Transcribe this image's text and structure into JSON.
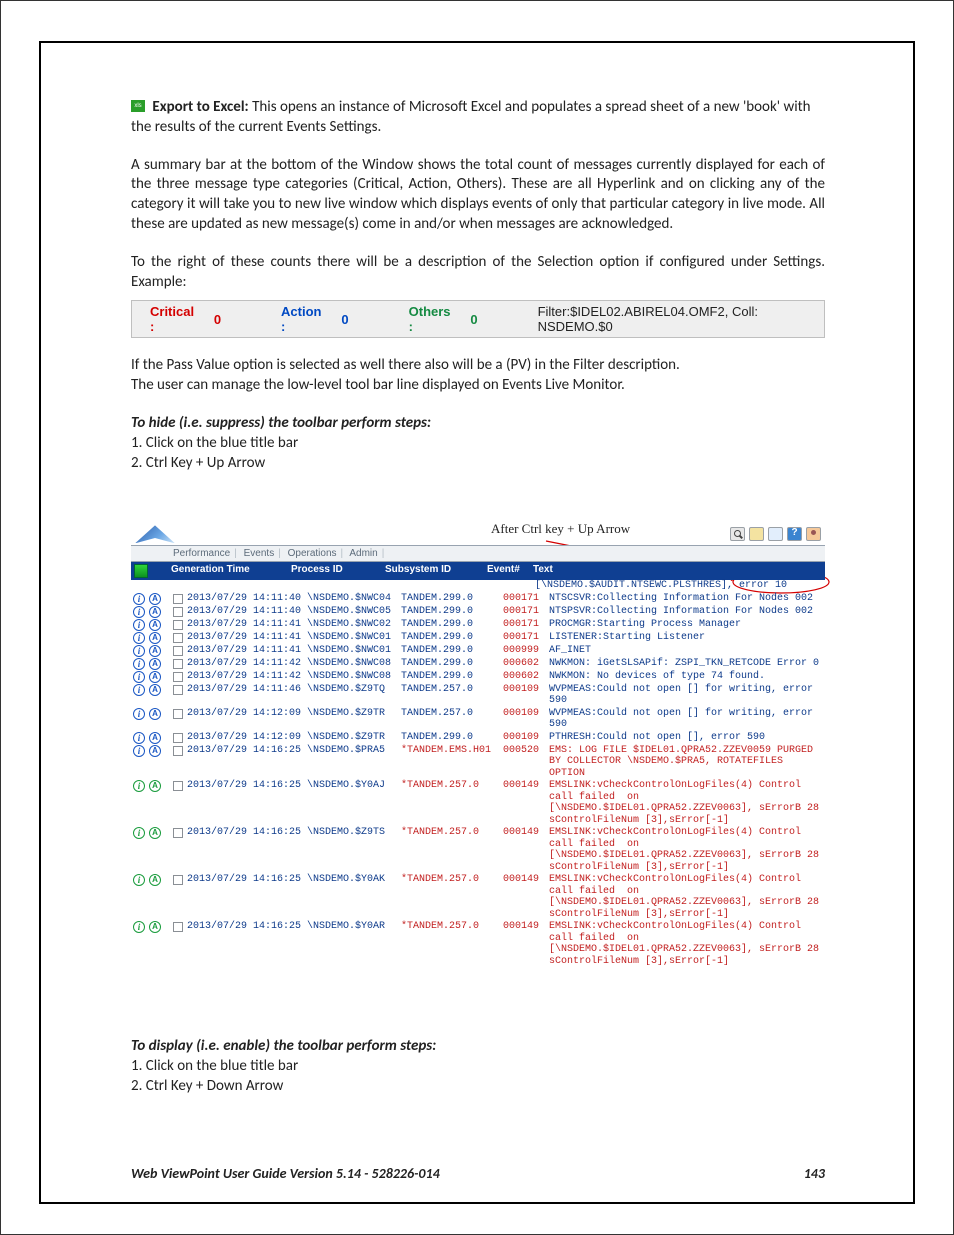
{
  "intro": {
    "export_strong": "Export to Excel:",
    "export_rest": " This opens an instance of Microsoft Excel and populates a spread sheet of a new 'book' with the results of the current Events Settings.",
    "summary_para": "A summary bar at the bottom of the Window shows the total count of messages currently displayed for each of the three message type categories (Critical, Action, Others). These are all Hyperlink and on clicking any of the category it will take you to new live window which displays events of only that particular category in live mode. All these are updated as new message(s) come in and/or when messages are acknowledged.",
    "right_para": "To the right of these counts there will be a description of the Selection option if configured under Settings. Example:"
  },
  "summary_bar": {
    "critical_label": "Critical :",
    "critical_value": "0",
    "action_label": "Action :",
    "action_value": "0",
    "others_label": "Others :",
    "others_value": "0",
    "filter_text": "Filter:$IDEL02.ABIREL04.OMF2, Coll: NSDEMO.$0"
  },
  "mid": {
    "pv_line": "If the Pass Value option is selected as well there also will be a (PV) in the Filter description.",
    "manage_line": "The user can manage the low-level tool bar line displayed on Events Live Monitor.",
    "hide_heading": "To hide (i.e. suppress) the toolbar perform steps:",
    "hide_step1": "1. Click on the blue title bar",
    "hide_step2": "2. Ctrl Key + Up Arrow",
    "callout": "After Ctrl key + Up Arrow"
  },
  "app": {
    "menu": {
      "perf": "Performance",
      "evt": "Events",
      "ops": "Operations",
      "adm": "Admin"
    },
    "head": {
      "gen": "Generation Time",
      "proc": "Process ID",
      "sub": "Subsystem ID",
      "ev": "Event#",
      "txt": "Text"
    },
    "pre_row_text": "[\\NSDEMO.$AUDIT.NTSEWC.PLSTHRES], error 10",
    "rows": [
      {
        "sev": "blue",
        "gt": "2013/07/29 14:11:40",
        "pid": "\\NSDEMO.$NWC04",
        "sub": "TANDEM.299.0",
        "sub_c": "blue",
        "ev": "000171",
        "ev_c": "red",
        "txt": "NTSCSVR:Collecting Information For Nodes 002",
        "txt_c": "blue"
      },
      {
        "sev": "blue",
        "gt": "2013/07/29 14:11:40",
        "pid": "\\NSDEMO.$NWC05",
        "sub": "TANDEM.299.0",
        "sub_c": "blue",
        "ev": "000171",
        "ev_c": "red",
        "txt": "NTSPSVR:Collecting Information For Nodes 002",
        "txt_c": "blue"
      },
      {
        "sev": "blue",
        "gt": "2013/07/29 14:11:41",
        "pid": "\\NSDEMO.$NWC02",
        "sub": "TANDEM.299.0",
        "sub_c": "blue",
        "ev": "000171",
        "ev_c": "red",
        "txt": "PROCMGR:Starting Process Manager",
        "txt_c": "blue"
      },
      {
        "sev": "blue",
        "gt": "2013/07/29 14:11:41",
        "pid": "\\NSDEMO.$NWC01",
        "sub": "TANDEM.299.0",
        "sub_c": "blue",
        "ev": "000171",
        "ev_c": "red",
        "txt": "LISTENER:Starting Listener",
        "txt_c": "blue"
      },
      {
        "sev": "blue",
        "gt": "2013/07/29 14:11:41",
        "pid": "\\NSDEMO.$NWC01",
        "sub": "TANDEM.299.0",
        "sub_c": "blue",
        "ev": "000999",
        "ev_c": "red",
        "txt": "AF_INET",
        "txt_c": "blue"
      },
      {
        "sev": "blue",
        "gt": "2013/07/29 14:11:42",
        "pid": "\\NSDEMO.$NWC08",
        "sub": "TANDEM.299.0",
        "sub_c": "blue",
        "ev": "000602",
        "ev_c": "red",
        "txt": "NWKMON: iGetSLSAPif: ZSPI_TKN_RETCODE Error 0",
        "txt_c": "blue"
      },
      {
        "sev": "blue",
        "gt": "2013/07/29 14:11:42",
        "pid": "\\NSDEMO.$NWC08",
        "sub": "TANDEM.299.0",
        "sub_c": "blue",
        "ev": "000602",
        "ev_c": "red",
        "txt": "NWKMON: No devices of type 74 found.",
        "txt_c": "blue"
      },
      {
        "sev": "blue",
        "gt": "2013/07/29 14:11:46",
        "pid": "\\NSDEMO.$Z9TQ",
        "sub": "TANDEM.257.0",
        "sub_c": "blue",
        "ev": "000109",
        "ev_c": "red",
        "txt": "WVPMEAS:Could not open [] for writing, error 590",
        "txt_c": "blue"
      },
      {
        "sev": "blue",
        "gt": "2013/07/29 14:12:09",
        "pid": "\\NSDEMO.$Z9TR",
        "sub": "TANDEM.257.0",
        "sub_c": "blue",
        "ev": "000109",
        "ev_c": "red",
        "txt": "WVPMEAS:Could not open [] for writing, error 590",
        "txt_c": "blue"
      },
      {
        "sev": "blue",
        "gt": "2013/07/29 14:12:09",
        "pid": "\\NSDEMO.$Z9TR",
        "sub": "TANDEM.299.0",
        "sub_c": "blue",
        "ev": "000109",
        "ev_c": "red",
        "txt": "PTHRESH:Could not open [], error 590",
        "txt_c": "blue"
      },
      {
        "sev": "blue",
        "gt": "2013/07/29 14:16:25",
        "pid": "\\NSDEMO.$PRA5",
        "sub": "*TANDEM.EMS.H01",
        "sub_c": "red",
        "ev": "000520",
        "ev_c": "red",
        "txt": "EMS: LOG FILE $IDEL01.QPRA52.ZZEV0059 PURGED BY COLLECTOR \\NSDEMO.$PRA5, ROTATEFILES OPTION",
        "txt_c": "red"
      },
      {
        "sev": "green",
        "gt": "2013/07/29 14:16:25",
        "pid": "\\NSDEMO.$Y0AJ",
        "sub": "*TANDEM.257.0",
        "sub_c": "red",
        "ev": "000149",
        "ev_c": "red",
        "txt": "EMSLINK:vCheckControlOnLogFiles(4) Control call failed  on [\\NSDEMO.$IDEL01.QPRA52.ZZEV0063], sErrorB 28 sControlFileNum [3],sError[-1]",
        "txt_c": "red"
      },
      {
        "sev": "green",
        "gt": "2013/07/29 14:16:25",
        "pid": "\\NSDEMO.$Z9TS",
        "sub": "*TANDEM.257.0",
        "sub_c": "red",
        "ev": "000149",
        "ev_c": "red",
        "txt": "EMSLINK:vCheckControlOnLogFiles(4) Control call failed  on [\\NSDEMO.$IDEL01.QPRA52.ZZEV0063], sErrorB 28 sControlFileNum [3],sError[-1]",
        "txt_c": "red"
      },
      {
        "sev": "green",
        "gt": "2013/07/29 14:16:25",
        "pid": "\\NSDEMO.$Y0AK",
        "sub": "*TANDEM.257.0",
        "sub_c": "red",
        "ev": "000149",
        "ev_c": "red",
        "txt": "EMSLINK:vCheckControlOnLogFiles(4) Control call failed  on [\\NSDEMO.$IDEL01.QPRA52.ZZEV0063], sErrorB 28 sControlFileNum [3],sError[-1]",
        "txt_c": "red"
      },
      {
        "sev": "green",
        "gt": "2013/07/29 14:16:25",
        "pid": "\\NSDEMO.$Y0AR",
        "sub": "*TANDEM.257.0",
        "sub_c": "red",
        "ev": "000149",
        "ev_c": "red",
        "txt": "EMSLINK:vCheckControlOnLogFiles(4) Control call failed  on [\\NSDEMO.$IDEL01.QPRA52.ZZEV0063], sErrorB 28 sControlFileNum [3],sError[-1]",
        "txt_c": "red"
      }
    ]
  },
  "display": {
    "heading": "To display (i.e. enable) the toolbar perform steps:",
    "step1": "1. Click on the blue title bar",
    "step2": "2. Ctrl Key + Down Arrow"
  },
  "footer": {
    "title": "Web ViewPoint User Guide Version 5.14 - 528226-014",
    "page": "143"
  }
}
